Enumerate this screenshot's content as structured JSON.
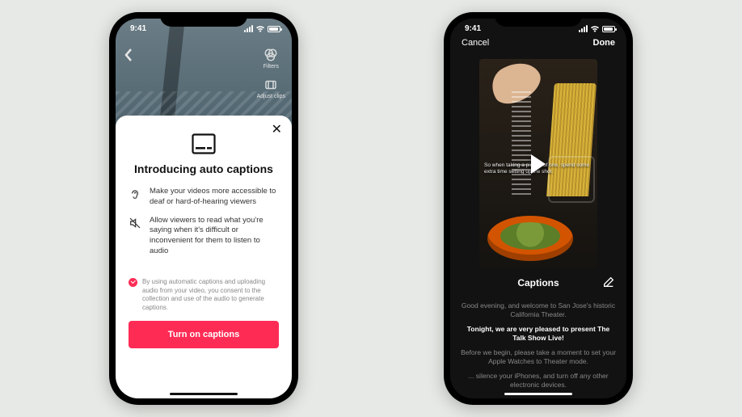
{
  "status": {
    "time": "9:41"
  },
  "leftPhone": {
    "tools": {
      "filters": "Filters",
      "adjustClips": "Adjust clips"
    },
    "sheet": {
      "title": "Introducing auto captions",
      "feature1": "Make your videos more accessible to deaf or hard-of-hearing viewers",
      "feature2": "Allow viewers to read what you're saying when it's difficult or inconvenient for them to listen to audio",
      "consent": "By using automatic captions and uploading audio from your video, you consent to the collection and use of the audio to generate captions.",
      "cta": "Turn on captions"
    }
  },
  "rightPhone": {
    "nav": {
      "cancel": "Cancel",
      "done": "Done"
    },
    "videoCaption": "So when taking a picture of one, spend some extra time setting up the shot.",
    "captionsLabel": "Captions",
    "lines": [
      "Good evening, and welcome to San Jose's historic California Theater.",
      "Tonight, we are very pleased to present The Talk Show Live!",
      "Before we begin, please take a moment to set your Apple Watches to Theater mode.",
      "... silence your iPhones, and turn off any other electronic devices."
    ]
  }
}
